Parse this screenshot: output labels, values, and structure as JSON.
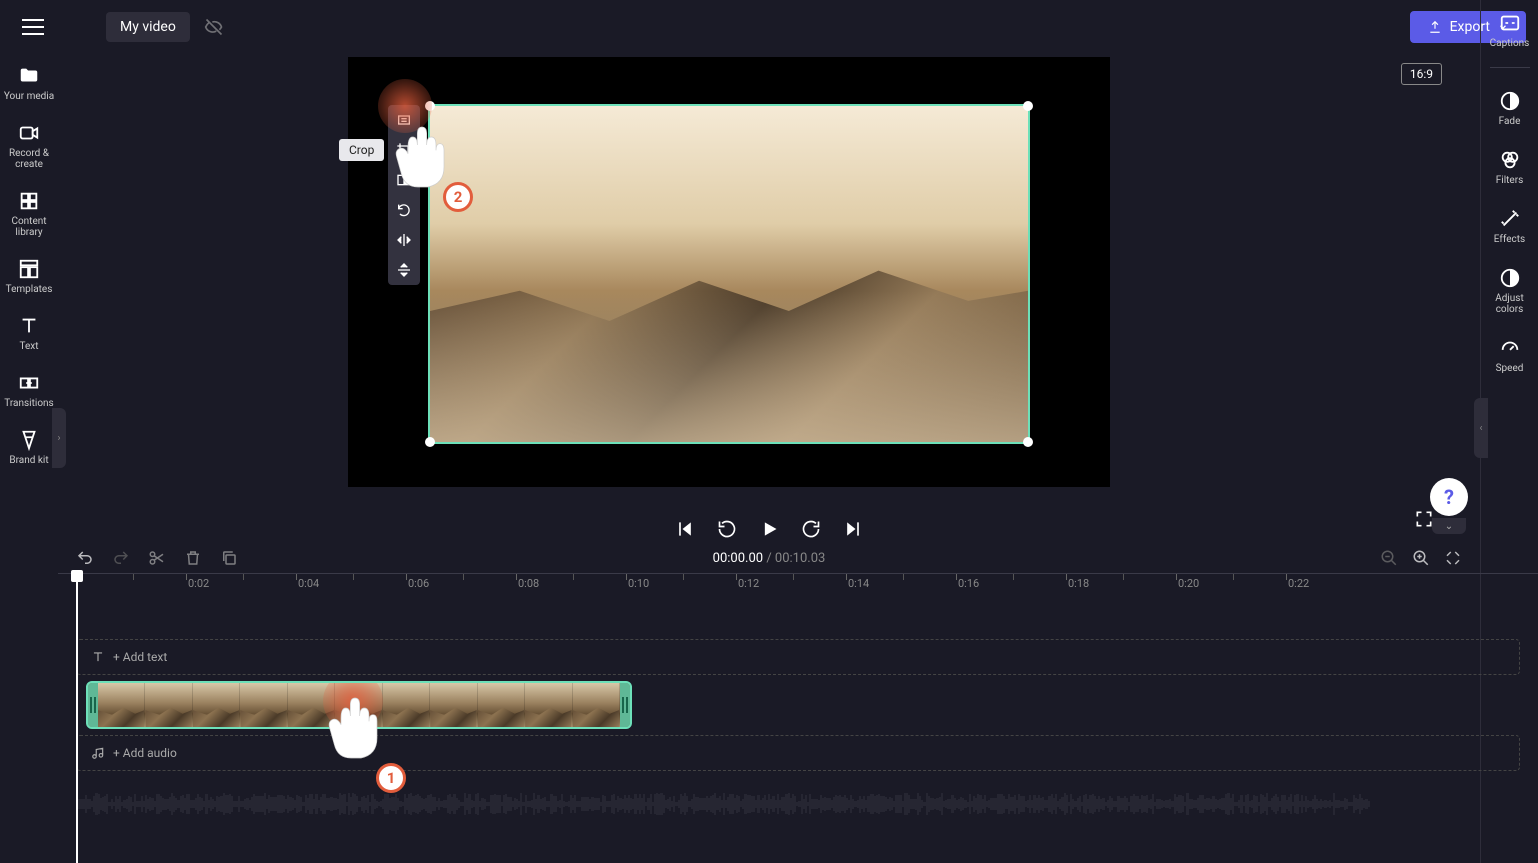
{
  "header": {
    "project_name": "My video",
    "export_label": "Export"
  },
  "left_sidebar": {
    "your_media": "Your media",
    "record_create": "Record & create",
    "content_library": "Content library",
    "templates": "Templates",
    "text": "Text",
    "transitions": "Transitions",
    "brand_kit": "Brand kit"
  },
  "right_sidebar": {
    "captions": "Captions",
    "fade": "Fade",
    "filters": "Filters",
    "effects": "Effects",
    "adjust_colors": "Adjust colors",
    "speed": "Speed"
  },
  "canvas": {
    "aspect_ratio": "16:9",
    "crop_tooltip": "Crop"
  },
  "timeline": {
    "current_time": "00:00.00",
    "total_time": "00:10.03",
    "add_text": "+ Add text",
    "add_audio": "+ Add audio",
    "ruler_marks": [
      "0:02",
      "0:04",
      "0:06",
      "0:08",
      "0:10",
      "0:12",
      "0:14",
      "0:16",
      "0:18",
      "0:20",
      "0:22"
    ]
  },
  "annotations": {
    "badge1": "1",
    "badge2": "2"
  },
  "help": {
    "label": "?"
  }
}
